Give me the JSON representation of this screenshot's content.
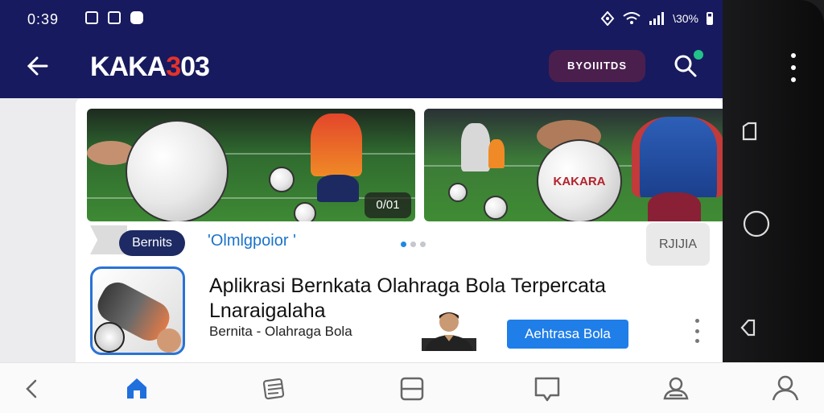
{
  "status_bar": {
    "time": "0:39",
    "right_text": "\\30%",
    "icons": [
      "image-icon",
      "photo-icon",
      "notification-icon",
      "location-icon",
      "wifi-icon",
      "signal-icon",
      "battery-icon"
    ]
  },
  "app_bar": {
    "logo_main": "KAKA",
    "logo_accent": "3",
    "logo_tail": "03",
    "action_button": "BYOIIITDS"
  },
  "banners": {
    "counter": "0/01",
    "ball_text": "KAKARA"
  },
  "content": {
    "tag": "Bernits",
    "category": "'Olmlgpoior '",
    "side_button": "RJIJIA",
    "app_title": "Aplikrasi Bernkata Olahraga Bola Terpercata",
    "app_subtitle": "Lnaraigalaha",
    "app_category": "Bernita - Olahraga Bola",
    "install_button": "Aehtrasa Bola"
  },
  "colors": {
    "header": "#171a5e",
    "accent_blue": "#1f7ee8",
    "pill": "#4a1f4e",
    "logo_red": "#e5322d"
  },
  "carousel": {
    "pages": 3,
    "active": 1
  },
  "nav": {
    "items": [
      "back-icon",
      "home-icon",
      "list-icon",
      "tab-icon",
      "chat-icon",
      "community-icon",
      "profile-icon"
    ]
  }
}
